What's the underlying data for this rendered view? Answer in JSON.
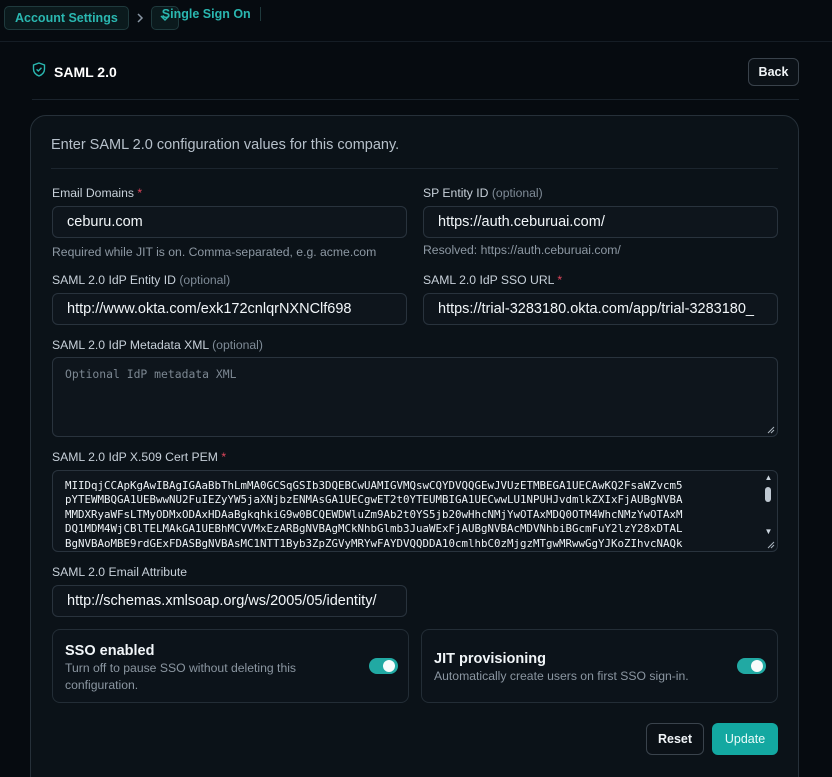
{
  "breadcrumb": {
    "account_settings": "Account Settings",
    "current": "Single Sign On"
  },
  "header": {
    "title": "SAML 2.0",
    "back_label": "Back"
  },
  "form": {
    "intro": "Enter SAML 2.0 configuration values for this company.",
    "email_domains": {
      "label": "Email Domains",
      "required_mark": "*",
      "value": "ceburu.com",
      "help": "Required while JIT is on. Comma-separated, e.g. acme.com"
    },
    "sp_entity_id": {
      "label": "SP Entity ID",
      "optional": "(optional)",
      "value": "https://auth.ceburuai.com/",
      "help": "Resolved: https://auth.ceburuai.com/"
    },
    "idp_entity_id": {
      "label": "SAML 2.0 IdP Entity ID",
      "optional": "(optional)",
      "value": "http://www.okta.com/exk172cnlqrNXNClf698"
    },
    "idp_sso_url": {
      "label": "SAML 2.0 IdP SSO URL",
      "required_mark": "*",
      "value": "https://trial-3283180.okta.com/app/trial-3283180_"
    },
    "idp_metadata_xml": {
      "label": "SAML 2.0 IdP Metadata XML",
      "optional": "(optional)",
      "placeholder": "Optional IdP metadata XML"
    },
    "idp_cert": {
      "label": "SAML 2.0 IdP X.509 Cert PEM",
      "required_mark": "*",
      "lines": [
        "MIIDqjCCApKgAwIBAgIGAaBbThLmMA0GCSqGSIb3DQEBCwUAMIGVMQswCQYDVQQGEwJVUzETMBEGA1UECAwKQ2FsaWZvcm5",
        "pYTEWMBQGA1UEBwwNU2FuIEZyYW5jaXNjbzENMAsGA1UECgwET2t0YTEUMBIGA1UECwwLU1NPUHJvdmlkZXIxFjAUBgNVBA",
        "MMDXRyaWFsLTMyODMxODAxHDAaBgkqhkiG9w0BCQEWDWluZm9Ab2t0YS5jb20wHhcNMjYwOTAxMDQ0OTM4WhcNMzYwOTAxM",
        "DQ1MDM4WjCBlTELMAkGA1UEBhMCVVMxEzARBgNVBAgMCkNhbGlmb3JuaWExFjAUBgNVBAcMDVNhbiBGcmFuY2lzY28xDTAL",
        "BgNVBAoMBE9rdGExFDASBgNVBAsMC1NTT1Byb3ZpZGVyMRYwFAYDVQQDDA10cmlhbC0zMjgzMTgwMRwwGgYJKoZIhvcNAQk"
      ]
    },
    "email_attribute": {
      "label": "SAML 2.0 Email Attribute",
      "value": "http://schemas.xmlsoap.org/ws/2005/05/identity/"
    },
    "sso_enabled": {
      "title": "SSO enabled",
      "description_line1": "Turn off to pause SSO without deleting this",
      "description_line2": "configuration.",
      "on": true
    },
    "jit_provisioning": {
      "title": "JIT provisioning",
      "description": "Automatically create users on first SSO sign-in.",
      "on": true
    },
    "reset_label": "Reset",
    "update_label": "Update"
  },
  "colors": {
    "accent": "#21a9a3",
    "required": "#e0465c",
    "background": "#060b10"
  }
}
